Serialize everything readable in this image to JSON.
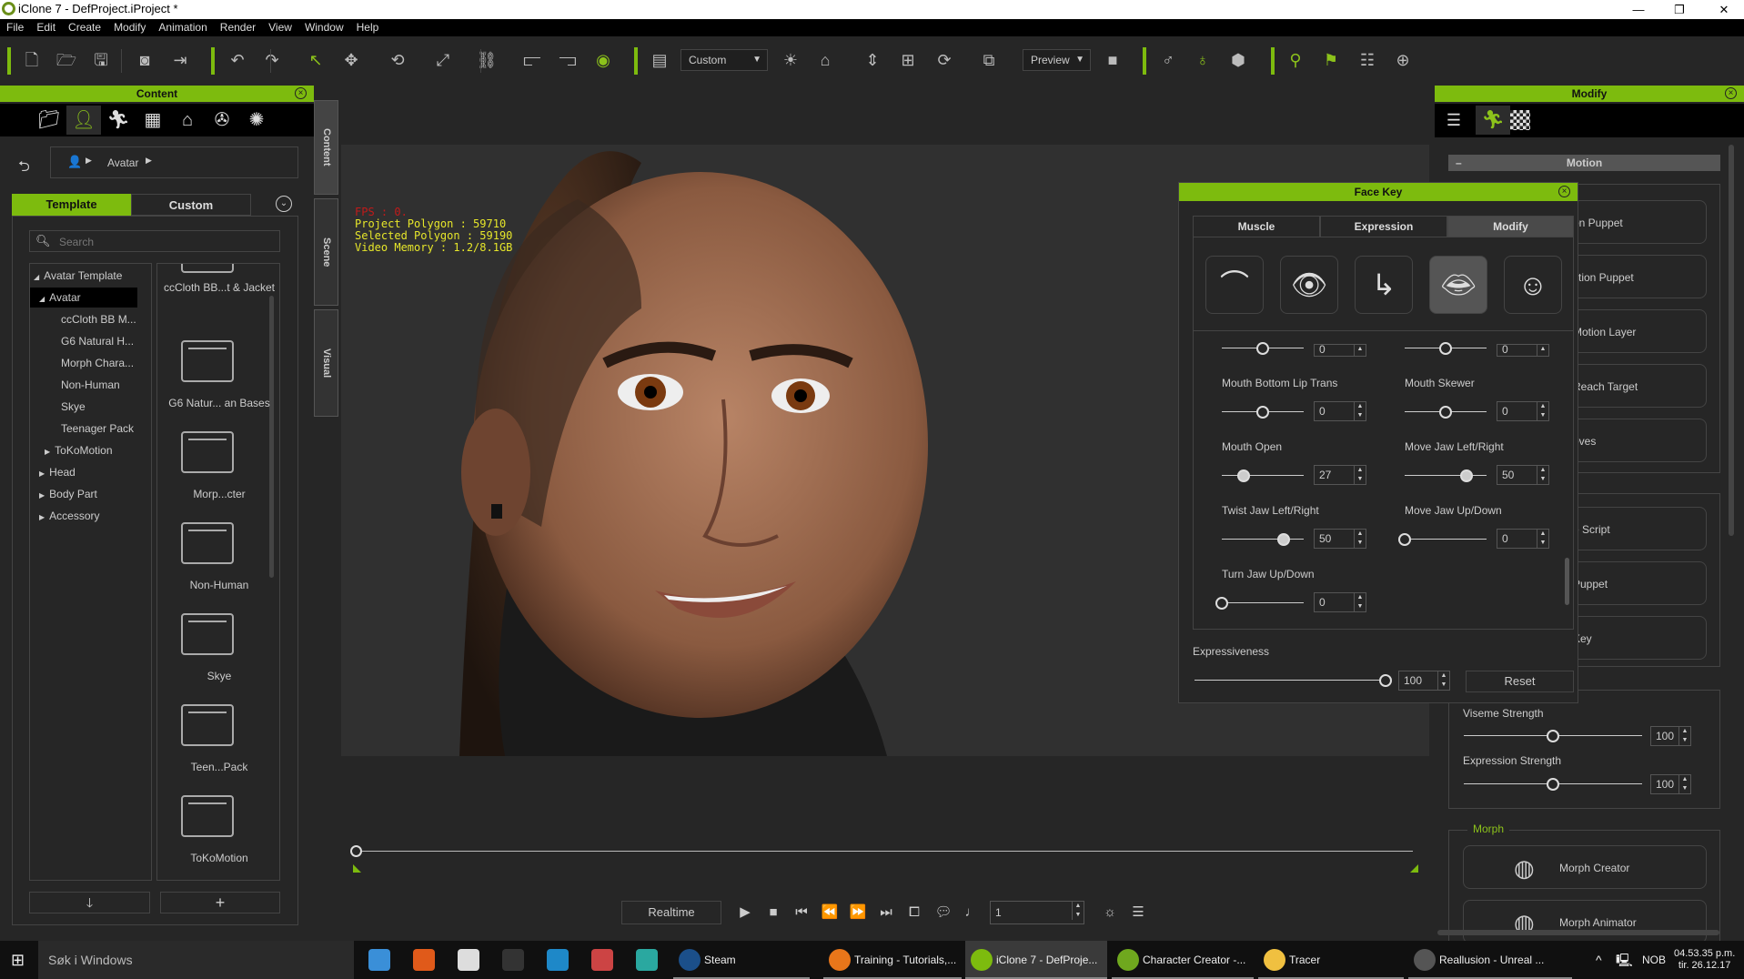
{
  "window": {
    "title": "iClone 7 - DefProject.iProject *",
    "controls": [
      "minimize",
      "restore",
      "close"
    ]
  },
  "menu": [
    "File",
    "Edit",
    "Create",
    "Modify",
    "Animation",
    "Render",
    "View",
    "Window",
    "Help"
  ],
  "toolbar": {
    "icons": [
      "new-file",
      "open-folder",
      "save",
      "render-preview",
      "export",
      "undo",
      "redo",
      "select",
      "move",
      "rotate",
      "scale",
      "link",
      "align-left",
      "align-distribute",
      "visibility-eye",
      "viewport-layout",
      "light",
      "home-camera",
      "fit-vertical",
      "fit-all",
      "camera-orbit",
      "box-view",
      "camera",
      "character-gizmo",
      "character-visibility",
      "props-group",
      "pose-pin",
      "flag",
      "timeline-list",
      "attach"
    ],
    "camera_select": "Custom",
    "preview_select": "Preview"
  },
  "content_panel": {
    "title": "Content",
    "tab_icons": [
      "folder",
      "avatar",
      "motion",
      "scene",
      "prop",
      "media",
      "atmosphere"
    ],
    "breadcrumb": "Avatar",
    "tabs": [
      "Template",
      "Custom"
    ],
    "active_tab": "Template",
    "search_placeholder": "Search",
    "tree": [
      {
        "label": "Avatar Template",
        "level": 0,
        "arrow": "open"
      },
      {
        "label": "Avatar",
        "level": 1,
        "arrow": "open",
        "selected": true
      },
      {
        "label": "ccCloth BB M...",
        "level": 2
      },
      {
        "label": "G6 Natural H...",
        "level": 2
      },
      {
        "label": "Morph Chara...",
        "level": 2
      },
      {
        "label": "Non-Human",
        "level": 2
      },
      {
        "label": "Skye",
        "level": 2
      },
      {
        "label": "Teenager Pack",
        "level": 2
      },
      {
        "label": "ToKoMotion",
        "level": 2,
        "arrow": "closed"
      },
      {
        "label": "Head",
        "level": 1,
        "arrow": "closed"
      },
      {
        "label": "Body Part",
        "level": 1,
        "arrow": "closed"
      },
      {
        "label": "Accessory",
        "level": 1,
        "arrow": "closed"
      }
    ],
    "grid": [
      "ccCloth BB...t & Jacket",
      "G6 Natur... an Bases",
      "Morp...cter",
      "Non-Human",
      "Skye",
      "Teen...Pack",
      "ToKoMotion"
    ],
    "bottom_buttons": [
      "download-arrow",
      "add-plus"
    ]
  },
  "side_tabs": [
    "Content",
    "Scene",
    "Visual"
  ],
  "viewport": {
    "fps": "FPS : 0.",
    "project_polygon": "Project Polygon : 59710",
    "selected_polygon": "Selected Polygon : 59190",
    "video_memory": "Video Memory : 1.2/8.1GB"
  },
  "playback": {
    "mode": "Realtime",
    "frame": "1",
    "icons": [
      "play",
      "stop",
      "first-frame",
      "prev-key",
      "next-key",
      "last-frame",
      "loop",
      "subtitle",
      "audio",
      "settings",
      "timeline"
    ]
  },
  "modify_panel": {
    "title": "Modify",
    "tab_icons": [
      "sliders",
      "motion",
      "checker"
    ],
    "section": "Motion",
    "buttons_group1": [
      "on Puppet",
      "ction Puppet",
      "Motion Layer",
      "Reach Target",
      "oves"
    ],
    "buttons_group2": [
      "e Script",
      "Puppet",
      "Key"
    ],
    "viseme_strength": {
      "label": "Viseme Strength",
      "value": "100",
      "fraction": 0.5
    },
    "expression_strength": {
      "label": "Expression Strength",
      "value": "100",
      "fraction": 0.5
    },
    "morph_group": "Morph",
    "morph_buttons": [
      "Morph Creator",
      "Morph Animator"
    ]
  },
  "face_key": {
    "title": "Face Key",
    "tabs": [
      "Muscle",
      "Expression",
      "Modify"
    ],
    "active_tab": "Modify",
    "region_icons": [
      "eyebrow",
      "eye",
      "nose",
      "mouth",
      "head"
    ],
    "active_region": "mouth",
    "sliders": [
      {
        "label": "",
        "value": "0",
        "range": [
          -100,
          100
        ],
        "col": 0,
        "partial": true
      },
      {
        "label": "",
        "value": "0",
        "range": [
          -100,
          100
        ],
        "col": 1,
        "partial": true
      },
      {
        "label": "Mouth Bottom Lip Trans",
        "value": "0",
        "range": [
          -100,
          100
        ],
        "col": 0
      },
      {
        "label": "Mouth Skewer",
        "value": "0",
        "range": [
          -100,
          100
        ],
        "col": 1
      },
      {
        "label": "Mouth Open",
        "value": "27",
        "range": [
          0,
          100
        ],
        "col": 0
      },
      {
        "label": "Move Jaw Left/Right",
        "value": "50",
        "range": [
          -100,
          100
        ],
        "col": 1
      },
      {
        "label": "Twist Jaw Left/Right",
        "value": "50",
        "range": [
          -100,
          100
        ],
        "col": 0
      },
      {
        "label": "Move Jaw Up/Down",
        "value": "0",
        "range": [
          0,
          100
        ],
        "col": 1
      },
      {
        "label": "Turn Jaw Up/Down",
        "value": "0",
        "range": [
          0,
          100
        ],
        "col": 0
      }
    ],
    "expressiveness": {
      "label": "Expressiveness",
      "value": "100",
      "fraction": 1
    },
    "reset": "Reset"
  },
  "taskbar": {
    "search": "Søk i Windows",
    "pinned": [
      "file-explorer",
      "app-orange",
      "foxit",
      "epic-games",
      "photoshop",
      "app-brush",
      "3ds-max"
    ],
    "apps": [
      "Steam",
      "Training - Tutorials,...",
      "iClone 7 - DefProje...",
      "Character Creator -...",
      "Tracer",
      "Reallusion - Unreal ..."
    ],
    "active_app": "iClone 7 - DefProje...",
    "language": "NOB",
    "time": "04.53.35 p.m.",
    "date": "tir. 26.12.17"
  },
  "colors": {
    "accent": "#7dbb0e",
    "stats": "#e6e62a",
    "fps": "#c21a1a"
  }
}
